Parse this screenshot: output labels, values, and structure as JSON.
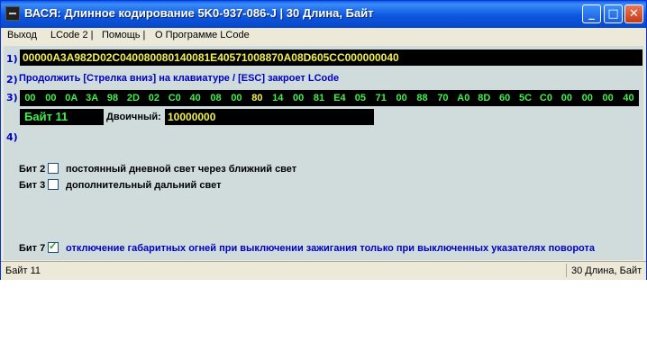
{
  "window": {
    "title": "ВАСЯ: Длинное кодирование  5K0-937-086-J  |  30 Длина, Байт",
    "title_color": "#ffffff",
    "titlebar_color": "#0c56e0"
  },
  "titlebar_buttons": {
    "minimize": "_",
    "maximize": "□",
    "close": "✕"
  },
  "menu": {
    "items": [
      "Выход",
      "LCode 2 |",
      "Помощь |",
      "О Программе LCode"
    ],
    "separators": [
      "|",
      "|"
    ]
  },
  "rows": {
    "row1_num": "1)",
    "row2_num": "2)",
    "row3_num": "3)",
    "row4_num": "4)"
  },
  "long_code": "00000A3A982D02C040080080140081E40571008870A08D605CC000000040",
  "hint": "Продолжить [Стрелка вниз] на клавиатуре / [ESC] закроет LCode",
  "bytes": [
    "00",
    "00",
    "0A",
    "3A",
    "98",
    "2D",
    "02",
    "C0",
    "40",
    "08",
    "00",
    "80",
    "14",
    "00",
    "81",
    "E4",
    "05",
    "71",
    "00",
    "88",
    "70",
    "A0",
    "8D",
    "60",
    "5C",
    "C0",
    "00",
    "00",
    "00",
    "40"
  ],
  "selected_byte_index": 11,
  "byte_label": "Байт 11",
  "binary_label": "Двоичный:",
  "binary_value": "10000000",
  "bits": [
    {
      "label": "Бит 2",
      "checked": false,
      "text": "постоянный дневной свет через ближний свет"
    },
    {
      "label": "Бит 3",
      "checked": false,
      "text": "дополнительный дальний свет"
    },
    {
      "label": "Бит 7",
      "checked": true,
      "text": "отключение габаритных огней при выключении зажигания только при выключенных указателях поворота"
    }
  ],
  "status": {
    "left": "Байт 11",
    "right": "30 Длина, Байт"
  },
  "colors": {
    "code_bg": "#000000",
    "code_text": "#f0f050",
    "byte_text": "#3ff04a",
    "hint_text": "#0000c0",
    "client_bg": "#d0dcdc"
  }
}
